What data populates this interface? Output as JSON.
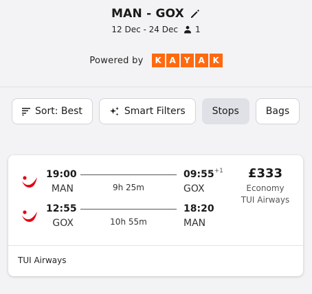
{
  "header": {
    "route": "MAN - GOX",
    "dates": "12 Dec - 24 Dec",
    "passengers": "1",
    "powered_by": "Powered by",
    "brand_letters": [
      "K",
      "A",
      "Y",
      "A",
      "K"
    ],
    "brand_color": "#ff690f"
  },
  "filters": {
    "sort_label": "Sort: Best",
    "smart_label": "Smart Filters",
    "stops_label": "Stops",
    "bags_label": "Bags"
  },
  "result": {
    "legs": [
      {
        "dep_time": "19:00",
        "dep_code": "MAN",
        "duration": "9h 25m",
        "arr_time": "09:55",
        "arr_offset": "+1",
        "arr_code": "GOX"
      },
      {
        "dep_time": "12:55",
        "dep_code": "GOX",
        "duration": "10h 55m",
        "arr_time": "18:20",
        "arr_offset": "",
        "arr_code": "MAN"
      }
    ],
    "price": "£333",
    "cabin": "Economy",
    "airline": "TUI Airways",
    "footer_airline": "TUI Airways",
    "airline_logo_color": "#e30613"
  }
}
